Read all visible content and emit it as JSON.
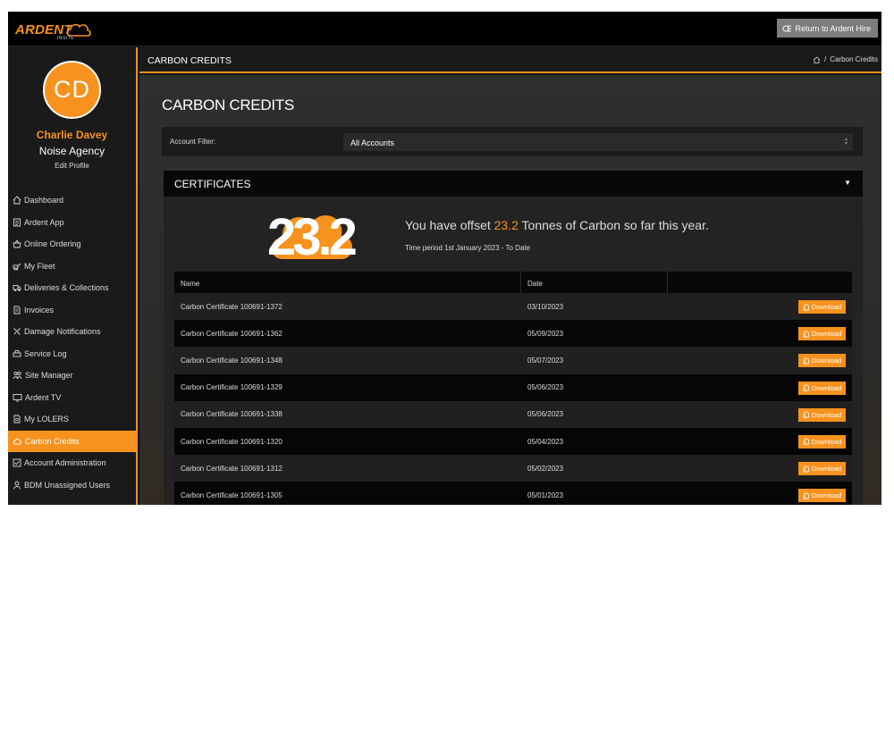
{
  "topbar": {
    "logo_word": "ARDENT",
    "logo_sub": "INSITE",
    "return_label": "Return to Ardent Hire"
  },
  "sidebar": {
    "avatar_initials": "CD",
    "user_name": "Charlie Davey",
    "user_org": "Noise Agency",
    "edit_profile": "Edit Profile",
    "items": [
      {
        "label": "Dashboard",
        "icon": "home-icon"
      },
      {
        "label": "Ardent App",
        "icon": "document-icon"
      },
      {
        "label": "Online Ordering",
        "icon": "basket-icon"
      },
      {
        "label": "My Fleet",
        "icon": "machine-icon"
      },
      {
        "label": "Deliveries & Collections",
        "icon": "truck-icon"
      },
      {
        "label": "Invoices",
        "icon": "invoice-icon"
      },
      {
        "label": "Damage Notifications",
        "icon": "tools-icon"
      },
      {
        "label": "Service Log",
        "icon": "printer-icon"
      },
      {
        "label": "Site Manager",
        "icon": "people-icon"
      },
      {
        "label": "Ardent TV",
        "icon": "monitor-icon"
      },
      {
        "label": "My LOLERS",
        "icon": "file-icon"
      },
      {
        "label": "Carbon Credits",
        "icon": "cloud-icon",
        "active": true
      },
      {
        "label": "Account Administration",
        "icon": "checkbox-icon"
      },
      {
        "label": "BDM Unassigned Users",
        "icon": "user-icon"
      }
    ]
  },
  "header": {
    "title": "CARBON CREDITS",
    "breadcrumb_current": "Carbon Credits",
    "breadcrumb_sep": "/"
  },
  "main": {
    "page_title": "CARBON CREDITS",
    "filter_label": "Account Filter:",
    "filter_value": "All Accounts"
  },
  "certificates": {
    "heading": "CERTIFICATES",
    "total": "23.2",
    "offset_prefix": "You have offset ",
    "offset_value": "23.2",
    "offset_suffix": " Tonnes of Carbon so far this year.",
    "period": "Time period 1st January 2023 - To Date",
    "columns": [
      "Name",
      "Date",
      ""
    ],
    "download_label": "Download",
    "rows": [
      {
        "name": "Carbon Certificate 100691-1372",
        "date": "03/10/2023"
      },
      {
        "name": "Carbon Certificate 100691-1362",
        "date": "05/09/2023"
      },
      {
        "name": "Carbon Certificate 100691-1348",
        "date": "05/07/2023"
      },
      {
        "name": "Carbon Certificate 100691-1329",
        "date": "05/06/2023"
      },
      {
        "name": "Carbon Certificate 100691-1338",
        "date": "05/06/2023"
      },
      {
        "name": "Carbon Certificate 100691-1320",
        "date": "05/04/2023"
      },
      {
        "name": "Carbon Certificate 100691-1312",
        "date": "05/02/2023"
      },
      {
        "name": "Carbon Certificate 100691-1305",
        "date": "05/01/2023"
      }
    ]
  },
  "colors": {
    "accent": "#f7921e",
    "background": "#141414"
  }
}
